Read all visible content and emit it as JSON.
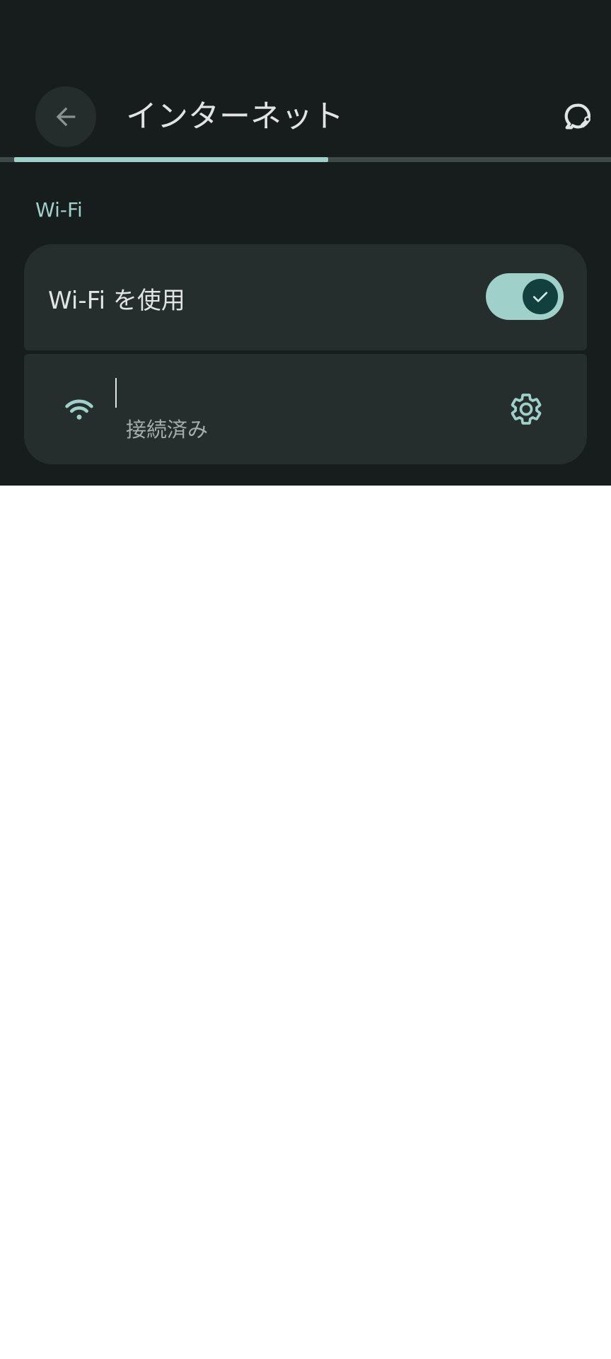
{
  "header": {
    "title": "インターネット",
    "back_icon": "arrow-left-icon",
    "help_icon": "help-feedback-icon"
  },
  "progress": {
    "fraction": 0.537,
    "accent": "#9fd0ca"
  },
  "wifi_section": {
    "label": "Wi-Fi",
    "toggle_label": "Wi-Fi を使用",
    "toggle_on": true,
    "network": {
      "name": "",
      "status": "接続済み",
      "signal_icon": "wifi-icon",
      "settings_icon": "gear-icon"
    }
  },
  "colors": {
    "background": "#171c1d",
    "card": "#252d2d",
    "accent": "#9fd0ca",
    "text": "#e1e4e3",
    "secondary_text": "#a6adac"
  }
}
